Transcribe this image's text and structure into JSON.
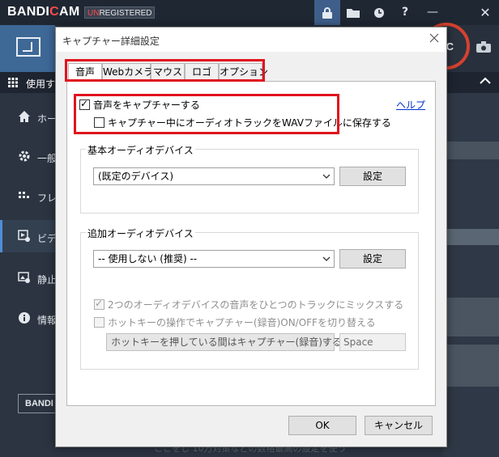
{
  "app": {
    "logo": "BANDICAM",
    "badge": "UNREGISTERED",
    "titlebar_icons": [
      "lock-icon",
      "folder-icon",
      "clock-icon",
      "help-icon",
      "minimize-icon",
      "close-icon"
    ],
    "help_glyph": "?",
    "minimize_glyph": "—",
    "close_glyph": "✕",
    "rec_label": "EC",
    "menu_label": "使用す",
    "sidebar": [
      {
        "label": "ホー",
        "icon": "home-icon"
      },
      {
        "label": "一般",
        "icon": "gear-icon"
      },
      {
        "label": "フレ",
        "icon": "fps-icon"
      },
      {
        "label": "ビデ",
        "icon": "video-settings-icon"
      },
      {
        "label": "静止",
        "icon": "image-icon"
      },
      {
        "label": "情報",
        "icon": "info-icon"
      }
    ],
    "footer_button": "BANDI",
    "bottom_hint": "ここをし 10万対策などの数格最高の設定を使う"
  },
  "dialog": {
    "title": "キャプチャー詳細設定",
    "tabs": [
      {
        "label": "音声",
        "active": true
      },
      {
        "label": "Webカメラ",
        "active": false
      },
      {
        "label": "マウス",
        "active": false
      },
      {
        "label": "ロゴ",
        "active": false
      },
      {
        "label": "オプション",
        "active": false
      }
    ],
    "capture_audio": {
      "label": "音声をキャプチャーする",
      "checked": true
    },
    "save_wav": {
      "label": "キャプチャー中にオーディオトラックをWAVファイルに保存する",
      "checked": false
    },
    "help_link": "ヘルプ",
    "basic_group": {
      "title": "基本オーディオデバイス",
      "device": "(既定のデバイス)",
      "settings_button": "設定"
    },
    "extra_group": {
      "title": "追加オーディオデバイス",
      "device": "-- 使用しない (推奨) --",
      "settings_button": "設定",
      "mix_tracks": {
        "label": "2つのオーディオデバイスの音声をひとつのトラックにミックスする",
        "checked": true,
        "enabled": false
      },
      "hotkey_toggle": {
        "label": "ホットキーの操作でキャプチャー(録音)ON/OFFを切り替える",
        "checked": false,
        "enabled": false
      },
      "hotkey_mode": "ホットキーを押している間はキャプチャー(録音)する",
      "hotkey_value": "Space"
    },
    "ok_button": "OK",
    "cancel_button": "キャンセル"
  },
  "colors": {
    "highlight": "#e0141e",
    "link": "#0033cc",
    "rec_ring": "#d5412f"
  }
}
